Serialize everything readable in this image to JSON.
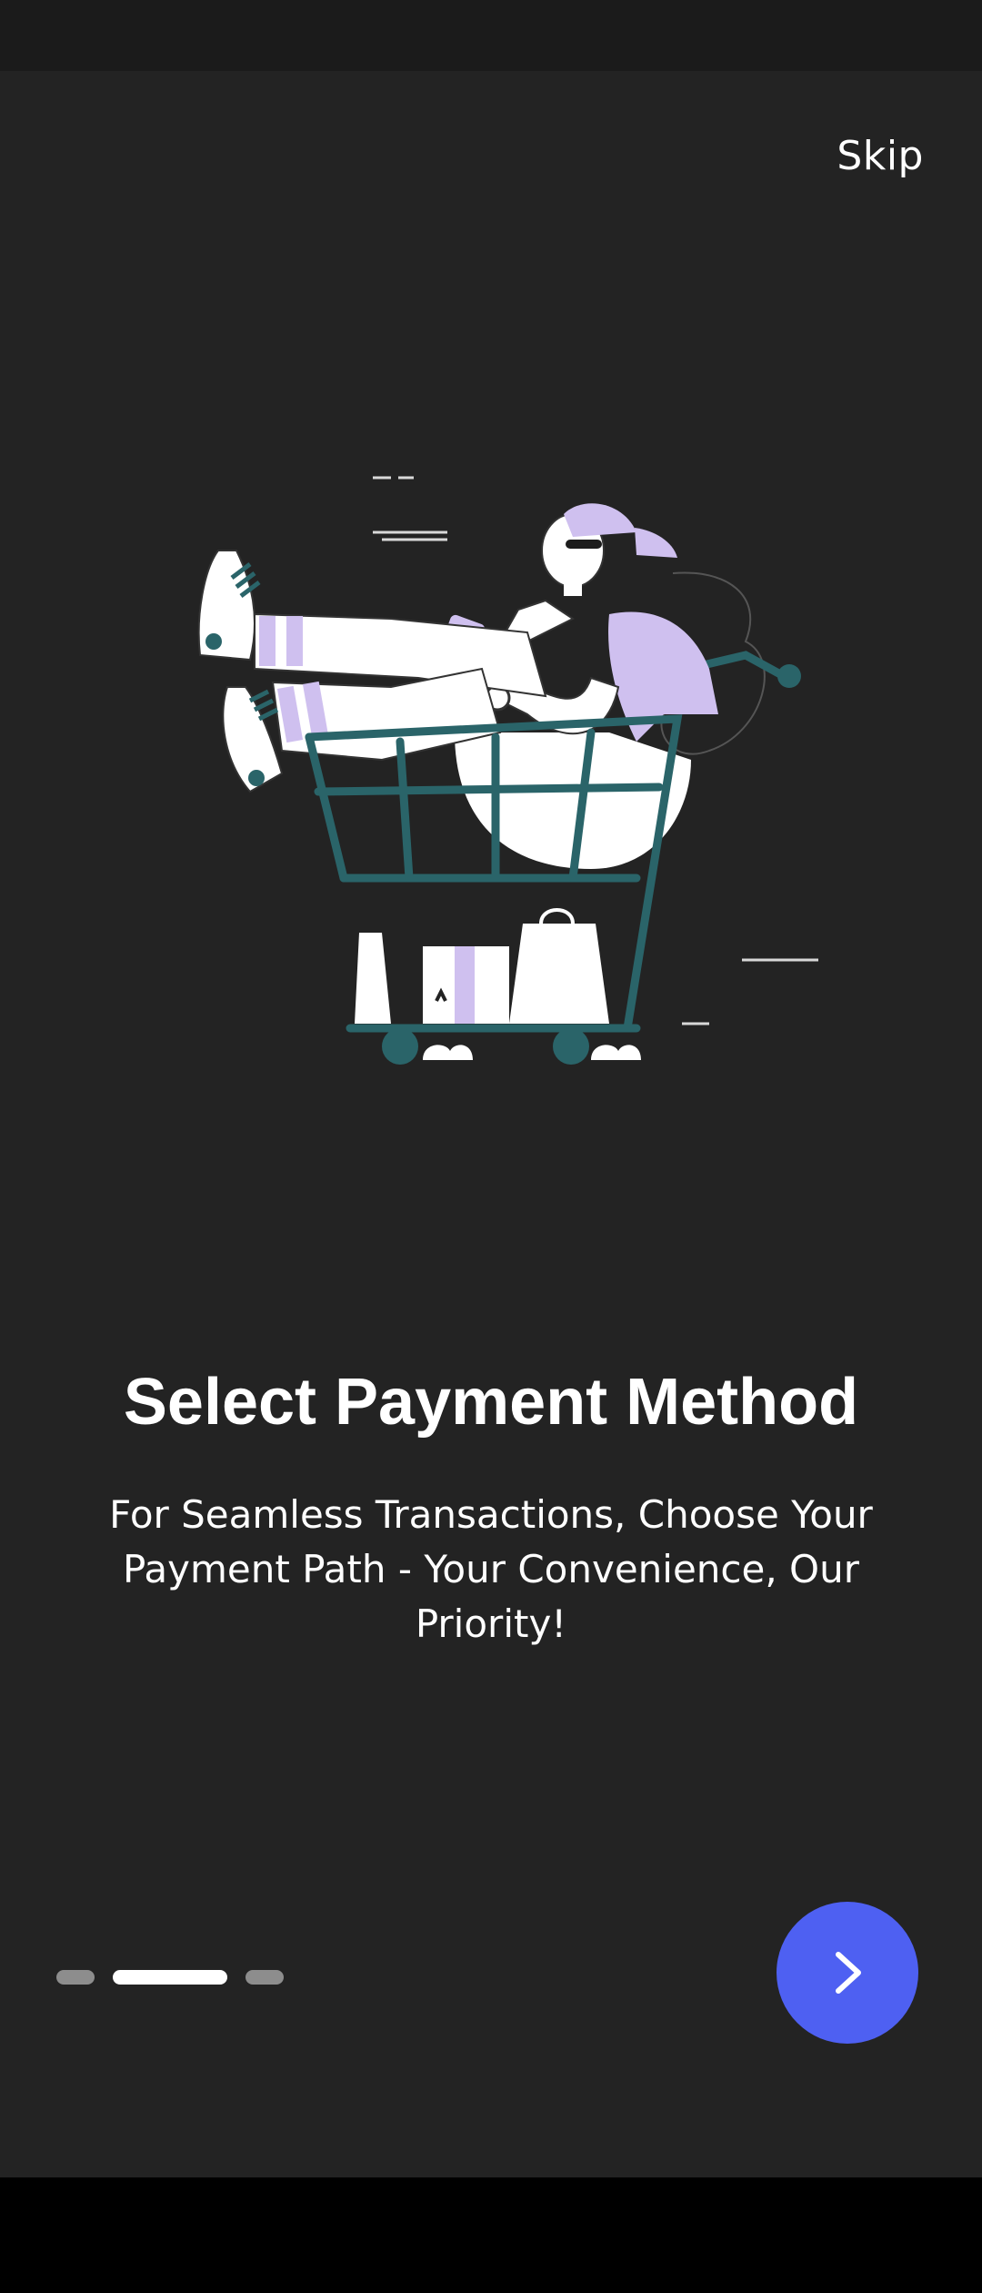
{
  "header": {
    "skip_label": "Skip"
  },
  "onboarding": {
    "title": "Select Payment Method",
    "subtitle": "For Seamless Transactions, Choose Your Payment Path - Your Convenience, Our Priority!",
    "current_page": 2,
    "total_pages": 3
  },
  "illustration": {
    "icon": "shopping-cart-illustration"
  },
  "next_button": {
    "icon": "chevron-right-icon"
  },
  "colors": {
    "background": "#232323",
    "accent": "#4e60f2",
    "lavender": "#cfc0ef",
    "teal": "#2a6469"
  }
}
